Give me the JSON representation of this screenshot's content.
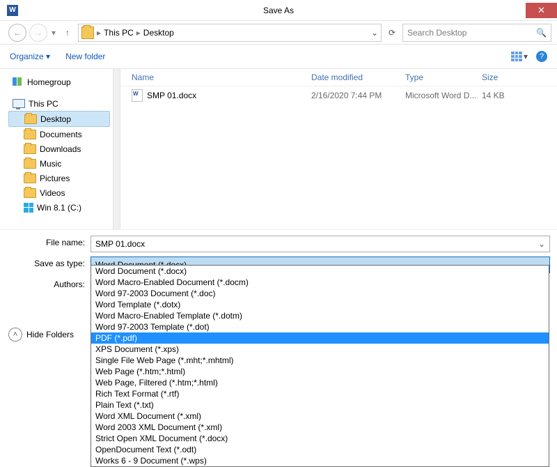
{
  "title": "Save As",
  "breadcrumb": {
    "root": "This PC",
    "leaf": "Desktop"
  },
  "search_placeholder": "Search Desktop",
  "toolbar": {
    "organize": "Organize",
    "newfolder": "New folder"
  },
  "columns": {
    "name": "Name",
    "date": "Date modified",
    "type": "Type",
    "size": "Size"
  },
  "rows": [
    {
      "name": "SMP 01.docx",
      "date": "2/16/2020 7:44 PM",
      "type": "Microsoft Word D...",
      "size": "14 KB"
    }
  ],
  "sidebar": {
    "homegroup": "Homegroup",
    "thispc": "This PC",
    "items": [
      "Desktop",
      "Documents",
      "Downloads",
      "Music",
      "Pictures",
      "Videos",
      "Win 8.1 (C:)"
    ],
    "truncated": "Win 8.1 (C:)"
  },
  "fields": {
    "filename_label": "File name:",
    "filename_value": "SMP 01.docx",
    "type_label": "Save as type:",
    "type_value": "Word Document (*.docx)",
    "authors_label": "Authors:"
  },
  "type_options": [
    "Word Document (*.docx)",
    "Word Macro-Enabled Document (*.docm)",
    "Word 97-2003 Document (*.doc)",
    "Word Template (*.dotx)",
    "Word Macro-Enabled Template (*.dotm)",
    "Word 97-2003 Template (*.dot)",
    "PDF (*.pdf)",
    "XPS Document (*.xps)",
    "Single File Web Page (*.mht;*.mhtml)",
    "Web Page (*.htm;*.html)",
    "Web Page, Filtered (*.htm;*.html)",
    "Rich Text Format (*.rtf)",
    "Plain Text (*.txt)",
    "Word XML Document (*.xml)",
    "Word 2003 XML Document (*.xml)",
    "Strict Open XML Document (*.docx)",
    "OpenDocument Text (*.odt)",
    "Works 6 - 9 Document (*.wps)"
  ],
  "type_selected_index": 6,
  "hide_folders": "Hide Folders"
}
